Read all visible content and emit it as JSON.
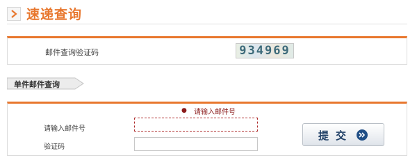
{
  "header": {
    "title": "速递查询",
    "icon": "chevron-right-icon"
  },
  "captcha": {
    "label": "邮件查询验证码",
    "code": "934969"
  },
  "tab": {
    "label": "单件邮件查询"
  },
  "form": {
    "error_message": "请输入邮件号",
    "mail_label": "请输入邮件号",
    "mail_value": "",
    "code_label": "验证码",
    "code_value": "",
    "submit_label": "提交",
    "submit_icon": "double-chevron-right-icon"
  },
  "colors": {
    "accent": "#e8772e",
    "error": "#8b1a1a",
    "button_text": "#1f3f66"
  }
}
